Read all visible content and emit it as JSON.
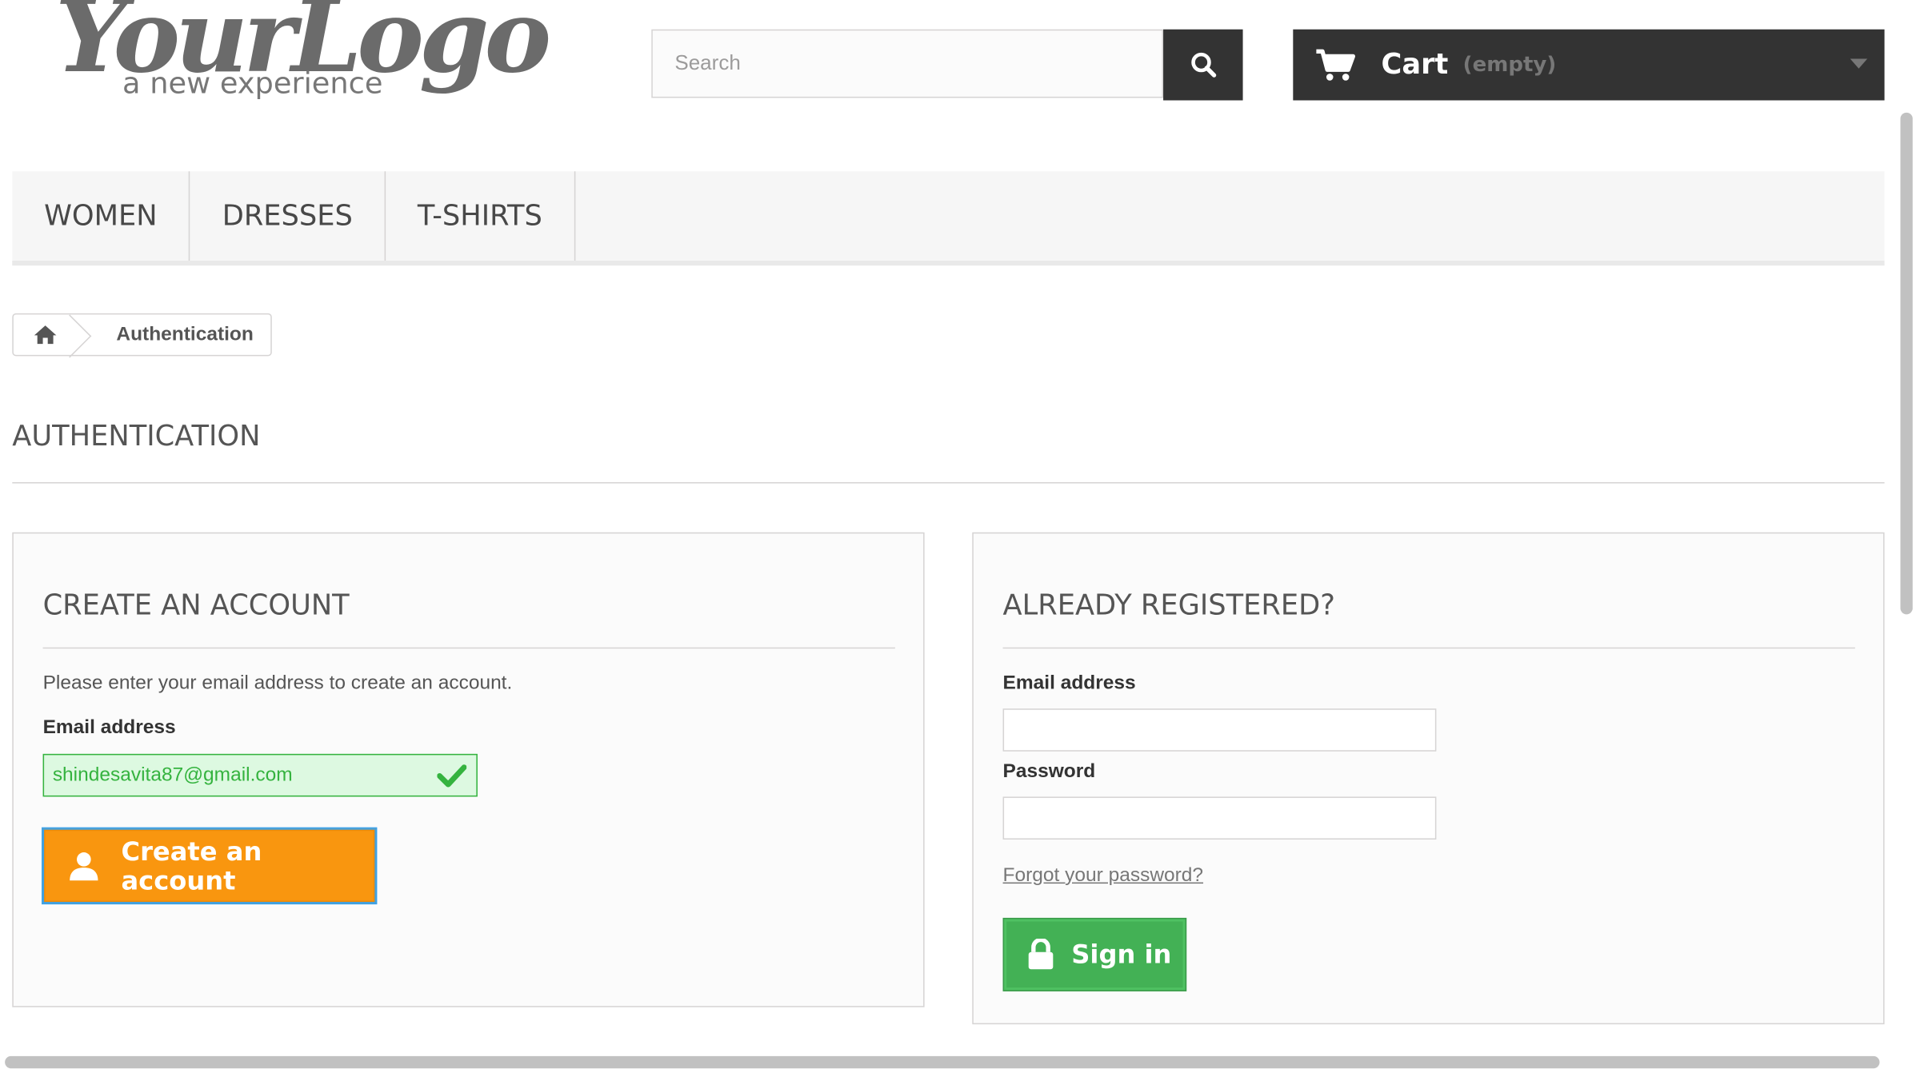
{
  "logo": {
    "script": "YourLogo",
    "tagline": "a new experience"
  },
  "search": {
    "placeholder": "Search"
  },
  "cart": {
    "label": "Cart",
    "status": "(empty)"
  },
  "nav": {
    "items": [
      {
        "label": "WOMEN"
      },
      {
        "label": "DRESSES"
      },
      {
        "label": "T-SHIRTS"
      }
    ]
  },
  "breadcrumb": {
    "current": "Authentication"
  },
  "page": {
    "heading": "AUTHENTICATION"
  },
  "create_account": {
    "title": "CREATE AN ACCOUNT",
    "hint": "Please enter your email address to create an account.",
    "email_label": "Email address",
    "email_value": "shindesavita87@gmail.com",
    "button": "Create an account"
  },
  "login": {
    "title": "ALREADY REGISTERED?",
    "email_label": "Email address",
    "password_label": "Password",
    "forgot": "Forgot your password?",
    "button": "Sign in"
  },
  "colors": {
    "dark": "#333333",
    "orange": "#f9960f",
    "green": "#43b155",
    "valid_green": "#35b33f"
  }
}
